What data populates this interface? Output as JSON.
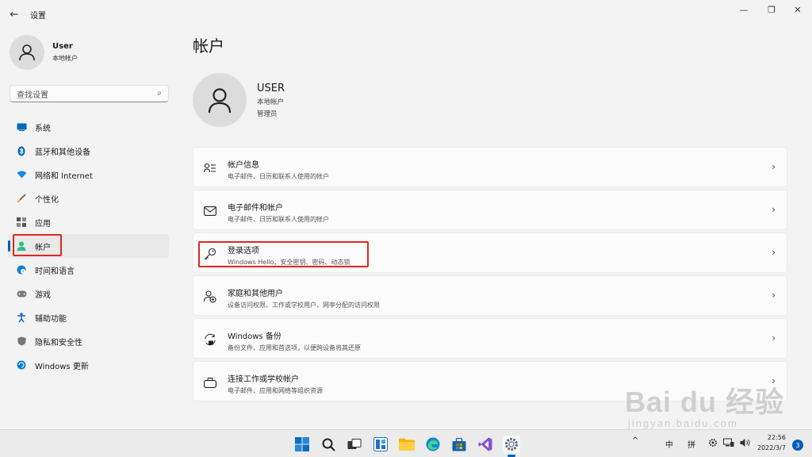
{
  "window": {
    "title": "设置",
    "back_icon": "←",
    "min_icon": "—",
    "max_icon": "❐",
    "close_icon": "✕"
  },
  "sidebar": {
    "user": {
      "name": "User",
      "type": "本地帐户"
    },
    "search": {
      "placeholder": "查找设置",
      "icon": "⌕"
    },
    "items": [
      {
        "label": "系统",
        "icon": "system-icon",
        "color": "#0067c0"
      },
      {
        "label": "蓝牙和其他设备",
        "icon": "bluetooth-icon",
        "color": "#0067c0"
      },
      {
        "label": "网络和 Internet",
        "icon": "wifi-icon",
        "color": "#1e88e5"
      },
      {
        "label": "个性化",
        "icon": "brush-icon",
        "color": "#e6a23c"
      },
      {
        "label": "应用",
        "icon": "apps-icon",
        "color": "#555555"
      },
      {
        "label": "帐户",
        "icon": "account-icon",
        "color": "#2bbd7e",
        "active": true
      },
      {
        "label": "时间和语言",
        "icon": "globe-clock-icon",
        "color": "#0f7fd6"
      },
      {
        "label": "游戏",
        "icon": "gamepad-icon",
        "color": "#666666"
      },
      {
        "label": "辅助功能",
        "icon": "accessibility-icon",
        "color": "#1565c0"
      },
      {
        "label": "隐私和安全性",
        "icon": "shield-icon",
        "color": "#666666"
      },
      {
        "label": "Windows 更新",
        "icon": "update-icon",
        "color": "#0f7fd6"
      }
    ]
  },
  "main": {
    "title": "帐户",
    "user": {
      "name": "USER",
      "line1": "本地帐户",
      "line2": "管理员"
    },
    "cards": [
      {
        "title": "帐户信息",
        "desc": "电子邮件、日历和联系人使用的帐户",
        "icon": "person-info-icon"
      },
      {
        "title": "电子邮件和帐户",
        "desc": "电子邮件、日历和联系人使用的帐户",
        "icon": "mail-icon"
      },
      {
        "title": "登录选项",
        "desc": "Windows Hello、安全密钥、密码、动态锁",
        "icon": "key-icon",
        "highlighted": true
      },
      {
        "title": "家庭和其他用户",
        "desc": "设备访问权限、工作或学校用户、网亭分配的访问权限",
        "icon": "family-icon"
      },
      {
        "title": "Windows 备份",
        "desc": "备份文件、应用和首选项，以便跨设备将其还原",
        "icon": "backup-icon"
      },
      {
        "title": "连接工作或学校帐户",
        "desc": "电子邮件、应用和网络等组织资源",
        "icon": "briefcase-icon"
      }
    ],
    "chevron": "›"
  },
  "taskbar": {
    "apps": [
      "start-icon",
      "search-icon",
      "task-view-icon",
      "widgets-icon",
      "file-explorer-icon",
      "edge-icon",
      "store-icon",
      "visual-studio-icon",
      "settings-icon"
    ],
    "tray_up": "^",
    "ime_lang": "中",
    "ime_mode": "拼",
    "time": "22:56",
    "date": "2022/3/7",
    "notifications": "3"
  },
  "watermark": {
    "logo": "Bai du 经验",
    "url": "jingyan.baidu.com"
  }
}
